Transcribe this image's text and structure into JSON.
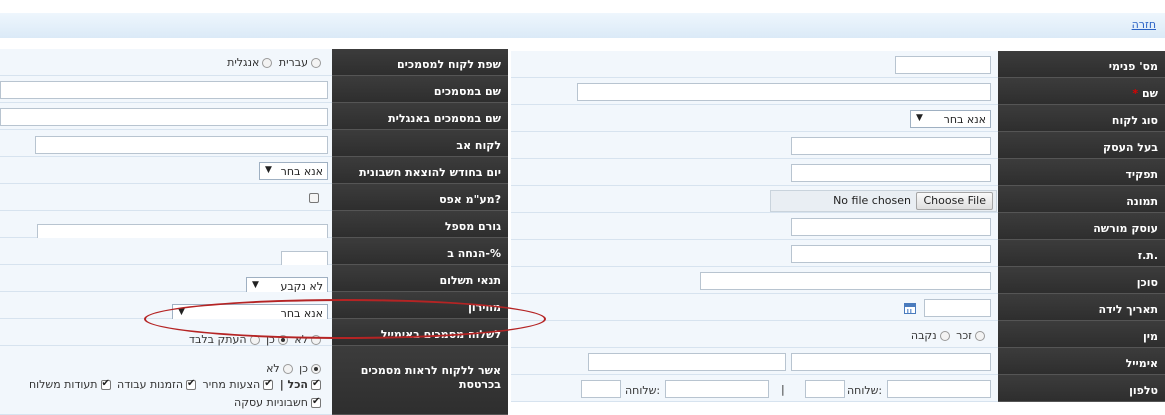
{
  "topbar": {
    "back_link": "חזרה"
  },
  "right": {
    "internal_no": "מס' פנימי",
    "name": "שם",
    "name_required": "*",
    "customer_type": "סוג לקוח",
    "customer_type_value": "אנא בחר",
    "business_owner": "בעל העסק",
    "role": "תפקיד",
    "image": "תמונה",
    "choose_file": "Choose File",
    "no_file": "No file chosen",
    "licensed_dealer": "עוסק מורשה",
    "id_no": "ת.ז.",
    "agent": "סוכן",
    "birth_date": "תאריך לידה",
    "gender": "מין",
    "male": "זכר",
    "female": "נקבה",
    "email": "אימייל",
    "phone": "טלפון",
    "extension1": "שלוחה:",
    "extension2": "שלוחה:",
    "separator": "|"
  },
  "left": {
    "doc_language": "שפת לקוח למסמכים",
    "hebrew": "עברית",
    "english": "אנגלית",
    "doc_name": "שם במסמכים",
    "doc_name_en": "שם במסמכים באנגלית",
    "parent_customer": "לקוח אב",
    "invoice_day": "יום בחודש להוצאת חשבונית",
    "invoice_day_value": "אנא בחר",
    "vat_zero": "מע\"מ אפס?",
    "referrer": "גורם מספל",
    "discount": "הנחה ב-%",
    "payment_terms": "תנאי תשלום",
    "payment_terms_value": "לא נקבע",
    "price_list": "מחירון",
    "price_list_value": "אנא בחר",
    "send_docs_email": "לשלוח מסמכים באימייל",
    "no": "לא",
    "yes": "כן",
    "copy_only": "העתק בלבד",
    "allow_view": "אשר ללקוח לראות מסמכים בכרטסת",
    "no2": "לא",
    "yes2": "כן",
    "all": "הכל |",
    "quotes": "הצעות מחיר",
    "work_orders": "הזמנות עבודה",
    "delivery_notes": "תעודות משלוח",
    "deal_invoices": "חשבוניות עסקה"
  },
  "colors": {
    "label_bg": "#333333",
    "field_bg": "#f2f7fc",
    "topbar": "#dbeaf7",
    "highlight": "#b52424",
    "link": "#2b63c6"
  }
}
